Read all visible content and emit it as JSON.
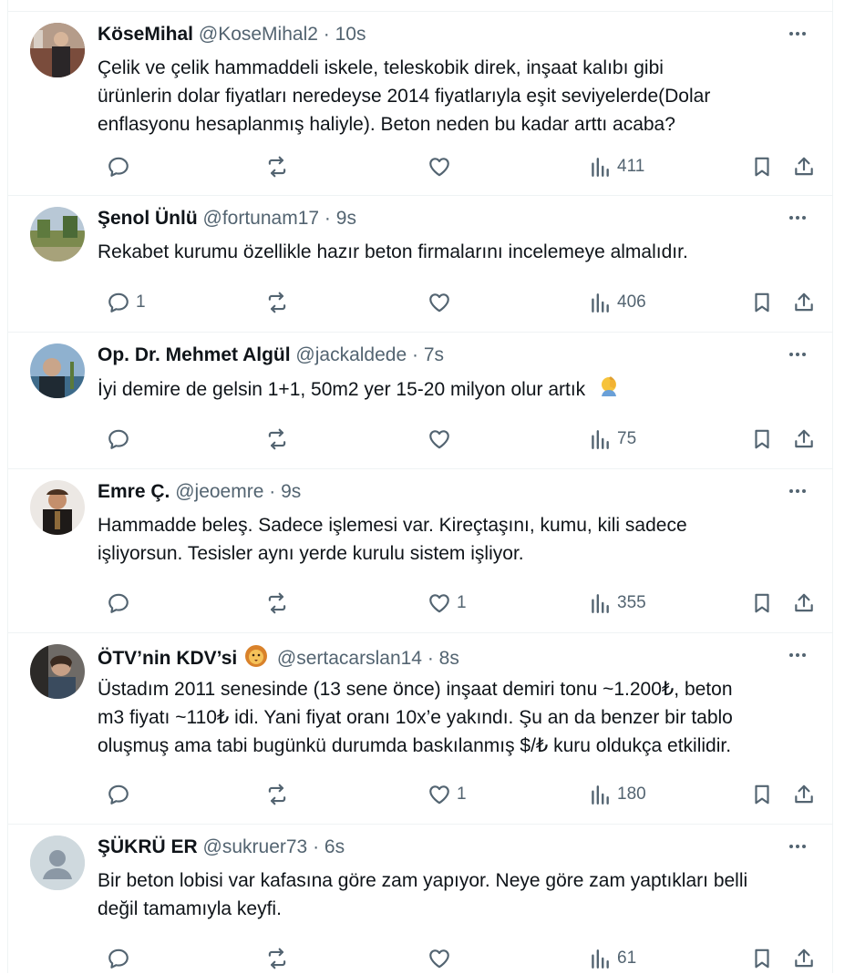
{
  "tweets": [
    {
      "name": "KöseMihal",
      "handle": "@KoseMihal2",
      "time": "10s",
      "text_lines": [
        "Çelik ve çelik hammaddeli iskele, teleskobik direk, inşaat kalıbı gibi",
        "ürünlerin dolar fiyatları neredeyse 2014 fiyatlarıyla eşit seviyelerde(Dolar",
        "enflasyonu hesaplanmış haliyle). Beton neden bu kadar arttı acaba?"
      ],
      "replies": "",
      "reposts": "",
      "likes": "",
      "views": "411"
    },
    {
      "name": "Şenol Ünlü",
      "handle": "@fortunam17",
      "time": "9s",
      "text_lines": [
        "Rekabet kurumu özellikle hazır beton firmalarını incelemeye almalıdır."
      ],
      "replies": "1",
      "reposts": "",
      "likes": "",
      "views": "406"
    },
    {
      "name": "Op. Dr. Mehmet Algül",
      "handle": "@jackaldede",
      "time": "7s",
      "text_lines": [
        "İyi demire de gelsin 1+1, 50m2 yer 15-20 milyon olur artık"
      ],
      "replies": "",
      "reposts": "",
      "likes": "",
      "views": "75"
    },
    {
      "name": "Emre Ç.",
      "handle": "@jeoemre",
      "time": "9s",
      "text_lines": [
        "Hammadde beleş. Sadece işlemesi var. Kireçtaşını, kumu, kili sadece",
        "işliyorsun. Tesisler aynı yerde kurulu sistem işliyor."
      ],
      "replies": "",
      "reposts": "",
      "likes": "1",
      "views": "355"
    },
    {
      "name": "ÖTV’nin KDV’si",
      "handle": "@sertacarslan14",
      "time": "8s",
      "text_lines": [
        "Üstadım 2011 senesinde (13 sene önce) inşaat demiri tonu ~1.200₺, beton",
        "m3 fiyatı ~110₺ idi. Yani fiyat oranı 10x’e yakındı. Şu an da benzer bir tablo",
        "oluşmuş ama tabi bugünkü durumda baskılanmış $/₺ kuru oldukça etkilidir."
      ],
      "replies": "",
      "reposts": "",
      "likes": "1",
      "views": "180"
    },
    {
      "name": "ŞÜKRÜ ER",
      "handle": "@sukruer73",
      "time": "6s",
      "text_lines": [
        "Bir beton lobisi var kafasına göre zam yapıyor. Neye göre zam yaptıkları belli",
        "değil tamamıyla keyfi."
      ],
      "replies": "",
      "reposts": "",
      "likes": "",
      "views": "61"
    }
  ],
  "dot": "·"
}
